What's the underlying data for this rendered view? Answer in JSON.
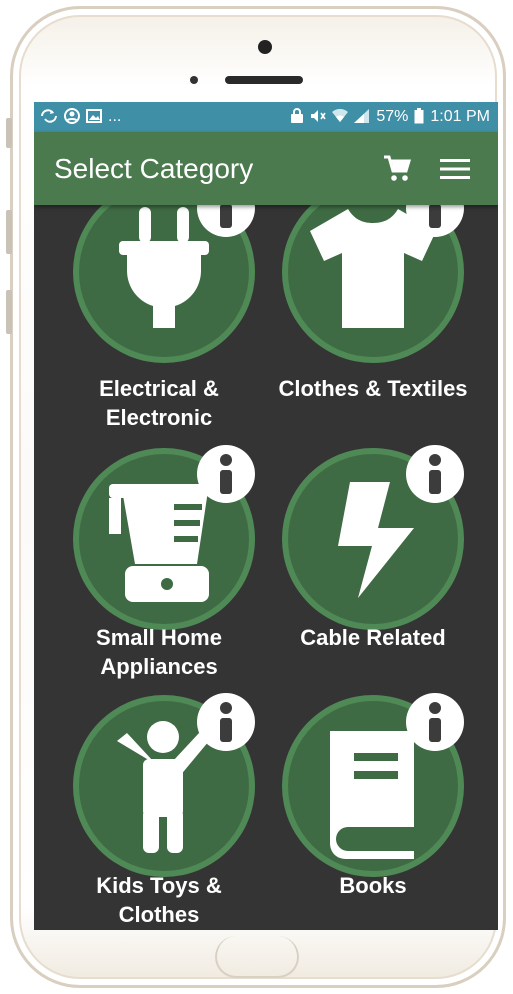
{
  "status": {
    "left_icons": [
      "sync-icon",
      "account-circle-icon",
      "image-icon"
    ],
    "left_more": "...",
    "battery": "57%",
    "time": "1:01 PM"
  },
  "appbar": {
    "title": "Select Category",
    "cart_icon": "cart-icon",
    "menu_icon": "menu-icon"
  },
  "categories": [
    {
      "label": "Electrical & Electronic",
      "icon": "plug-icon"
    },
    {
      "label": "Clothes & Textiles",
      "icon": "tshirt-icon"
    },
    {
      "label": "Small Home Appliances",
      "icon": "blender-icon"
    },
    {
      "label": "Cable Related",
      "icon": "bolt-icon"
    },
    {
      "label": "Kids Toys & Clothes",
      "icon": "child-icon"
    },
    {
      "label": "Books",
      "icon": "book-icon"
    }
  ],
  "colors": {
    "status_bar": "#3f8fa6",
    "app_bar": "#4a7a4e",
    "background": "#343434",
    "circle_fill": "#3f6b44",
    "circle_ring": "#4f8a56"
  }
}
